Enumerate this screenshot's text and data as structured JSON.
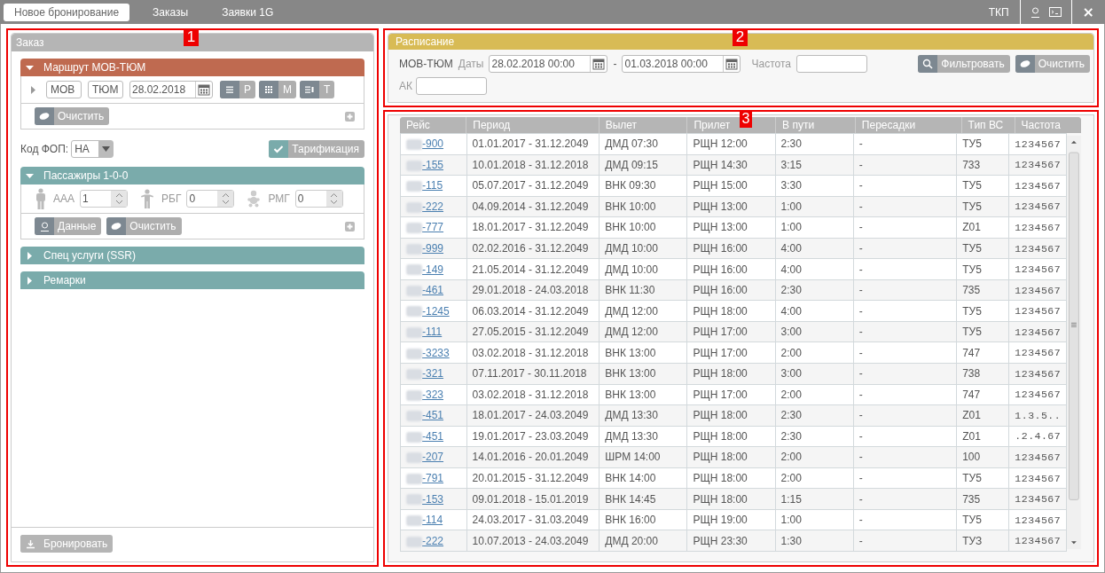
{
  "top_bar": {
    "tabs": [
      {
        "label": "Новое бронирование",
        "selected": true
      },
      {
        "label": "Заказы",
        "selected": false
      },
      {
        "label": "Заявки 1G",
        "selected": false
      }
    ],
    "user_label": "ТКП",
    "close": "×"
  },
  "order": {
    "callout": "1",
    "title": "Заказ",
    "route": {
      "title": "Маршрут МОВ-ТЮМ",
      "expanded": true,
      "segment_expanded": false,
      "from": "МОВ",
      "to": "ТЮМ",
      "date": "28.02.2018",
      "toggles": [
        {
          "kind": "list",
          "label": "Р"
        },
        {
          "kind": "grid",
          "label": "М"
        },
        {
          "kind": "tariff",
          "label": "Т"
        }
      ],
      "clear": "Очистить"
    },
    "fop": {
      "label": "Код ФОП:",
      "value": "НА"
    },
    "tariff_button": "Тарификация",
    "passengers": {
      "title": "Пассажиры 1-0-0",
      "expanded": true,
      "types": [
        {
          "kind": "adult",
          "label": "ААА",
          "value": "1"
        },
        {
          "kind": "child",
          "label": "РБГ",
          "value": "0"
        },
        {
          "kind": "infant",
          "label": "РМГ",
          "value": "0"
        }
      ],
      "data_button": "Данные",
      "clear": "Очистить"
    },
    "sections": [
      {
        "title": "Спец услуги (SSR)",
        "expanded": false
      },
      {
        "title": "Ремарки",
        "expanded": false
      }
    ],
    "book_button": {
      "label": "Бронировать",
      "disabled": true
    }
  },
  "schedule": {
    "callout": "2",
    "title": "Расписание",
    "route": "МОВ-ТЮМ",
    "dates_label": "Даты",
    "date_from": "28.02.2018 00:00",
    "date_separator": "-",
    "date_to": "01.03.2018 00:00",
    "frequency_label": "Частота",
    "airline_label": "АК",
    "filter_button": "Фильтровать",
    "clear_button": "Очистить"
  },
  "table": {
    "callout": "3",
    "columns": [
      "Рейс",
      "Период",
      "Вылет",
      "Прилет",
      "В пути",
      "Пересадки",
      "Тип ВС",
      "Частота"
    ],
    "rows": [
      [
        "-900",
        "01.01.2017 - 31.12.2049",
        "ДМД 07:30",
        "РЩН 12:00",
        "2:30",
        "-",
        "ТУ5",
        "1234567"
      ],
      [
        "-155",
        "10.01.2018 - 31.12.2018",
        "ДМД 09:15",
        "РЩН 14:30",
        "3:15",
        "-",
        "733",
        "1234567"
      ],
      [
        "-115",
        "05.07.2017 - 31.12.2049",
        "ВНК 09:30",
        "РЩН 15:00",
        "3:30",
        "-",
        "ТУ5",
        "1234567"
      ],
      [
        "-222",
        "04.09.2014 - 31.12.2049",
        "ВНК 10:00",
        "РЩН 13:00",
        "1:00",
        "-",
        "ТУ5",
        "1234567"
      ],
      [
        "-777",
        "18.01.2017 - 31.12.2049",
        "ВНК 10:00",
        "РЩН 13:00",
        "1:00",
        "-",
        "Z01",
        "1234567"
      ],
      [
        "-999",
        "02.02.2016 - 31.12.2049",
        "ДМД 10:00",
        "РЩН 16:00",
        "4:00",
        "-",
        "ТУ5",
        "1234567"
      ],
      [
        "-149",
        "21.05.2014 - 31.12.2049",
        "ДМД 10:00",
        "РЩН 16:00",
        "4:00",
        "-",
        "ТУ5",
        "1234567"
      ],
      [
        "-461",
        "29.01.2018 - 24.03.2018",
        "ВНК 11:30",
        "РЩН 16:00",
        "2:30",
        "-",
        "735",
        "1234567"
      ],
      [
        "-1245",
        "06.03.2014 - 31.12.2049",
        "ДМД 12:00",
        "РЩН 18:00",
        "4:00",
        "-",
        "ТУ5",
        "1234567"
      ],
      [
        "-111",
        "27.05.2015 - 31.12.2049",
        "ДМД 12:00",
        "РЩН 17:00",
        "3:00",
        "-",
        "ТУ5",
        "1234567"
      ],
      [
        "-3233",
        "03.02.2018 - 31.12.2018",
        "ВНК 13:00",
        "РЩН 17:00",
        "2:00",
        "-",
        "747",
        "1234567"
      ],
      [
        "-321",
        "07.11.2017 - 30.11.2018",
        "ВНК 13:00",
        "РЩН 18:00",
        "3:00",
        "-",
        "738",
        "1234567"
      ],
      [
        "-323",
        "03.02.2018 - 31.12.2018",
        "ВНК 13:00",
        "РЩН 17:00",
        "2:00",
        "-",
        "747",
        "1234567"
      ],
      [
        "-451",
        "18.01.2017 - 24.03.2049",
        "ДМД 13:30",
        "РЩН 18:00",
        "2:30",
        "-",
        "Z01",
        "1.3.5.."
      ],
      [
        "-451",
        "19.01.2017 - 23.03.2049",
        "ДМД 13:30",
        "РЩН 18:00",
        "2:30",
        "-",
        "Z01",
        ".2.4.67"
      ],
      [
        "-207",
        "14.01.2016 - 20.01.2049",
        "ШРМ 14:00",
        "РЩН 18:00",
        "2:00",
        "-",
        "100",
        "1234567"
      ],
      [
        "-791",
        "20.01.2015 - 31.12.2049",
        "ВНК 14:00",
        "РЩН 18:00",
        "2:00",
        "-",
        "ТУ5",
        "1234567"
      ],
      [
        "-153",
        "09.01.2018 - 15.01.2019",
        "ВНК 14:45",
        "РЩН 18:00",
        "1:15",
        "-",
        "735",
        "1234567"
      ],
      [
        "-114",
        "24.03.2017 - 31.03.2049",
        "ВНК 16:00",
        "РЩН 19:00",
        "1:00",
        "-",
        "ТУ5",
        "1234567"
      ],
      [
        "-222",
        "10.07.2013 - 24.03.2049",
        "ДМД 20:00",
        "РЩН 23:30",
        "1:30",
        "-",
        "ТУЗ",
        "1234567"
      ]
    ]
  }
}
